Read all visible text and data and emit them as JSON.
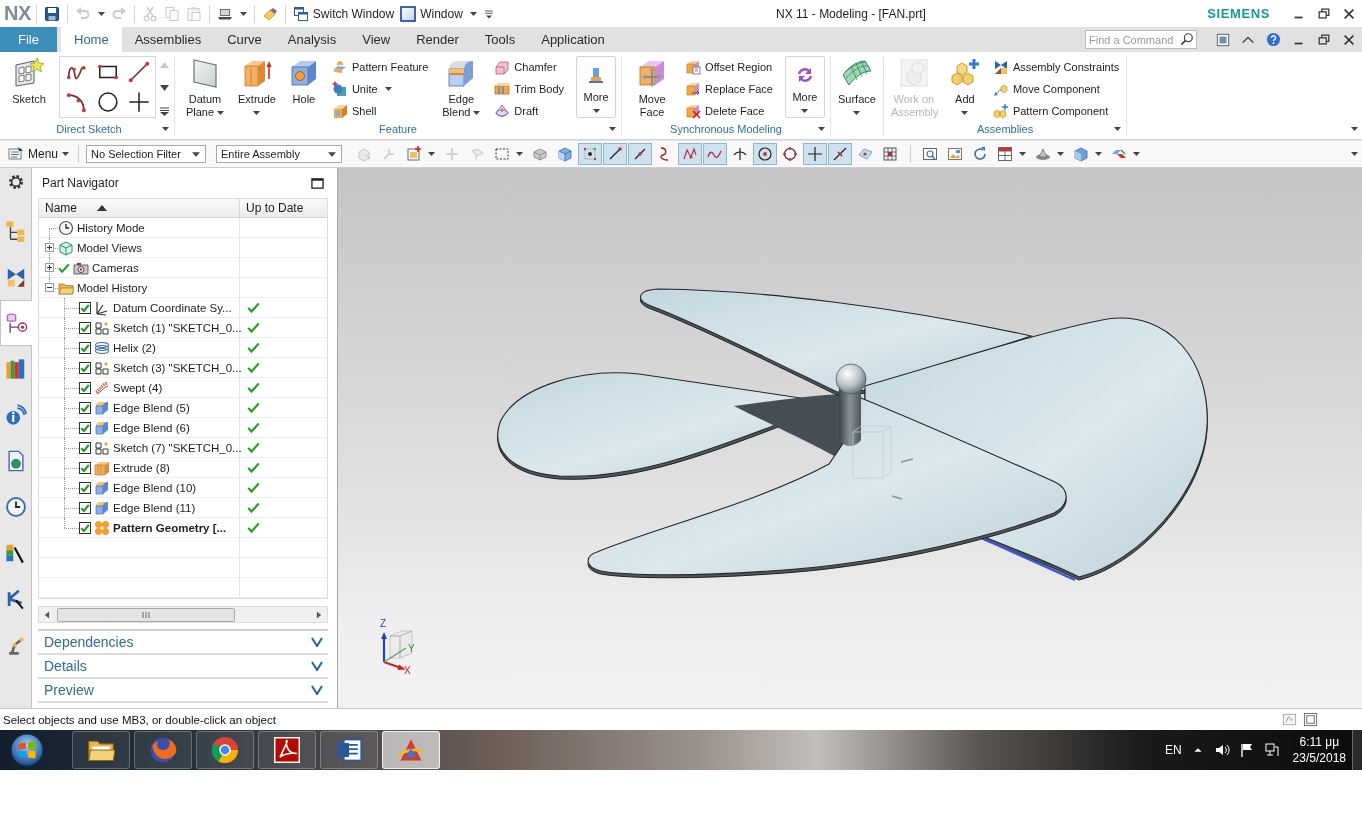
{
  "window": {
    "logo": "NX",
    "title": "NX 11 - Modeling - [FAN.prt]",
    "brand": "SIEMENS"
  },
  "quick_access": {
    "tool_groups": [
      [
        {
          "kind": "save",
          "disabled": false,
          "dropdown": false
        }
      ],
      [
        {
          "kind": "undo",
          "disabled": true,
          "dropdown": true
        },
        {
          "kind": "redo",
          "disabled": true,
          "dropdown": false
        }
      ],
      [
        {
          "kind": "cut",
          "disabled": true,
          "dropdown": false
        },
        {
          "kind": "copy",
          "disabled": true,
          "dropdown": false
        },
        {
          "kind": "paste",
          "disabled": true,
          "dropdown": false
        }
      ],
      [
        {
          "kind": "touch",
          "disabled": false,
          "dropdown": true
        }
      ],
      [
        {
          "kind": "eraser",
          "disabled": false,
          "dropdown": false
        }
      ]
    ],
    "buttons": [
      {
        "kind": "switch-window",
        "label": "Switch Window",
        "dropdown": false
      },
      {
        "kind": "window",
        "label": "Window",
        "dropdown": true
      }
    ]
  },
  "ribbon": {
    "tabs": [
      {
        "label": "File",
        "kind": "file",
        "selected": false
      },
      {
        "label": "Home",
        "kind": "tab",
        "selected": true
      },
      {
        "label": "Assemblies",
        "kind": "tab",
        "selected": false
      },
      {
        "label": "Curve",
        "kind": "tab",
        "selected": false
      },
      {
        "label": "Analysis",
        "kind": "tab",
        "selected": false
      },
      {
        "label": "View",
        "kind": "tab",
        "selected": false
      },
      {
        "label": "Render",
        "kind": "tab",
        "selected": false
      },
      {
        "label": "Tools",
        "kind": "tab",
        "selected": false
      },
      {
        "label": "Application",
        "kind": "tab",
        "selected": false
      }
    ],
    "search": {
      "placeholder": "Find a Command"
    },
    "groups": [
      {
        "label": "Direct Sketch",
        "launcher": true,
        "items": [
          {
            "kind": "sketch",
            "label": "Sketch",
            "dropdown": false,
            "disabled": false
          },
          {
            "kind": "gallery",
            "tools": [
              {
                "kind": "spline"
              },
              {
                "kind": "rectangle"
              },
              {
                "kind": "line"
              },
              {
                "kind": "arc"
              },
              {
                "kind": "circle"
              },
              {
                "kind": "point"
              }
            ]
          }
        ]
      },
      {
        "label": "Feature",
        "launcher": true,
        "items": [
          {
            "kind": "datum-plane",
            "label": "Datum Plane",
            "dropdown": true,
            "disabled": false
          },
          {
            "kind": "extrude",
            "label": "Extrude",
            "dropdown": true,
            "disabled": false
          },
          {
            "kind": "hole",
            "label": "Hole",
            "dropdown": false,
            "disabled": false
          },
          {
            "kind": "stack",
            "buttons": [
              {
                "kind": "pattern-feature",
                "label": "Pattern Feature",
                "dropdown": false
              },
              {
                "kind": "unite",
                "label": "Unite",
                "dropdown": true
              },
              {
                "kind": "shell",
                "label": "Shell",
                "dropdown": false
              }
            ]
          },
          {
            "kind": "edge-blend",
            "label": "Edge Blend",
            "dropdown": true,
            "disabled": false
          },
          {
            "kind": "stack",
            "buttons": [
              {
                "kind": "chamfer",
                "label": "Chamfer",
                "dropdown": false
              },
              {
                "kind": "trim-body",
                "label": "Trim Body",
                "dropdown": false
              },
              {
                "kind": "draft",
                "label": "Draft",
                "dropdown": false
              }
            ]
          },
          {
            "kind": "more-feature",
            "label": "More",
            "dropdown": true,
            "disabled": false
          }
        ]
      },
      {
        "label": "Synchronous Modeling",
        "launcher": true,
        "items": [
          {
            "kind": "move-face",
            "label": "Move Face",
            "dropdown": false,
            "disabled": false
          },
          {
            "kind": "stack",
            "buttons": [
              {
                "kind": "offset-region",
                "label": "Offset Region",
                "dropdown": false
              },
              {
                "kind": "replace-face",
                "label": "Replace Face",
                "dropdown": false
              },
              {
                "kind": "delete-face",
                "label": "Delete Face",
                "dropdown": false
              }
            ]
          },
          {
            "kind": "more-sync",
            "label": "More",
            "dropdown": true,
            "disabled": false
          }
        ]
      },
      {
        "launcher": false,
        "items": [
          {
            "kind": "surface",
            "label": "Surface",
            "dropdown": true,
            "disabled": false
          }
        ]
      },
      {
        "label": "Assemblies",
        "launcher": true,
        "items": [
          {
            "kind": "work-on-assembly",
            "label": "Work on Assembly",
            "dropdown": false,
            "disabled": true
          },
          {
            "kind": "add-component",
            "label": "Add",
            "dropdown": true,
            "disabled": false
          },
          {
            "kind": "stack",
            "buttons": [
              {
                "kind": "assembly-constraints",
                "label": "Assembly Constraints",
                "dropdown": false
              },
              {
                "kind": "move-component",
                "label": "Move Component",
                "dropdown": false
              },
              {
                "kind": "pattern-component",
                "label": "Pattern Component",
                "dropdown": false
              }
            ]
          }
        ]
      }
    ]
  },
  "toolbar": {
    "menu": "Menu",
    "selection_filter": "No Selection Filter",
    "assembly_scope": "Entire Assembly",
    "icon_groups": [
      [
        {
          "kind": "select-feature",
          "on": false,
          "disabled": true,
          "dropdown": false
        },
        {
          "kind": "select-arrow",
          "on": false,
          "disabled": true,
          "dropdown": false
        },
        {
          "kind": "box-plus",
          "on": false,
          "disabled": false,
          "dropdown": true
        },
        {
          "kind": "move-handle",
          "on": false,
          "disabled": true,
          "dropdown": false
        },
        {
          "kind": "select-face",
          "on": false,
          "disabled": true,
          "dropdown": false
        },
        {
          "kind": "dashed-rect",
          "on": false,
          "disabled": false,
          "dropdown": true
        },
        {
          "kind": "cube-grey",
          "on": false,
          "disabled": false,
          "dropdown": false
        },
        {
          "kind": "cube-blue",
          "on": false,
          "disabled": false,
          "dropdown": false
        },
        {
          "kind": "snap-grid",
          "on": true,
          "disabled": false,
          "dropdown": false
        },
        {
          "kind": "end-point",
          "on": true,
          "disabled": false,
          "dropdown": false
        },
        {
          "kind": "mid-point",
          "on": true,
          "disabled": false,
          "dropdown": false
        },
        {
          "kind": "curve",
          "on": false,
          "disabled": false,
          "dropdown": false
        },
        {
          "kind": "control-point",
          "on": true,
          "disabled": false,
          "dropdown": false
        },
        {
          "kind": "wave",
          "on": true,
          "disabled": false,
          "dropdown": false
        },
        {
          "kind": "intersection",
          "on": false,
          "disabled": false,
          "dropdown": false
        },
        {
          "kind": "arc-center",
          "on": true,
          "disabled": false,
          "dropdown": false
        },
        {
          "kind": "quadrant",
          "on": false,
          "disabled": false,
          "dropdown": false
        },
        {
          "kind": "existing-point",
          "on": true,
          "disabled": false,
          "dropdown": false
        },
        {
          "kind": "point-on-curve",
          "on": true,
          "disabled": false,
          "dropdown": false
        },
        {
          "kind": "point-on-surface",
          "on": false,
          "disabled": false,
          "dropdown": false
        },
        {
          "kind": "grid",
          "on": false,
          "disabled": false,
          "dropdown": false
        }
      ],
      [
        {
          "kind": "view-fit",
          "on": false,
          "disabled": false,
          "dropdown": false
        },
        {
          "kind": "image",
          "on": false,
          "disabled": false,
          "dropdown": false
        },
        {
          "kind": "refresh",
          "on": false,
          "disabled": false,
          "dropdown": false
        },
        {
          "kind": "layout",
          "on": false,
          "disabled": false,
          "dropdown": true
        },
        {
          "kind": "shade",
          "on": false,
          "disabled": false,
          "dropdown": true
        },
        {
          "kind": "cube-display",
          "on": false,
          "disabled": false,
          "dropdown": true
        },
        {
          "kind": "show-hide",
          "on": false,
          "disabled": false,
          "dropdown": true
        }
      ]
    ]
  },
  "resource_bar": [
    {
      "kind": "settings",
      "selected": false
    },
    {
      "kind": "assembly-navigator",
      "selected": false
    },
    {
      "kind": "constraint-navigator",
      "selected": false
    },
    {
      "kind": "part-navigator",
      "selected": true
    },
    {
      "kind": "reuse-library",
      "selected": false
    },
    {
      "kind": "hd3d",
      "selected": false
    },
    {
      "kind": "web-browser",
      "selected": false
    },
    {
      "kind": "history",
      "selected": false
    },
    {
      "kind": "process-studio",
      "selected": false
    },
    {
      "kind": "roles",
      "selected": false
    },
    {
      "kind": "system-scenes",
      "selected": false
    }
  ],
  "part_navigator": {
    "title": "Part Navigator",
    "columns": [
      {
        "label": "Name",
        "sorted": true
      },
      {
        "label": "Up to Date",
        "sorted": false
      }
    ],
    "nodes": [
      {
        "label": "History Mode",
        "kind": "history-mode",
        "ticked": false
      },
      {
        "label": "Model Views",
        "kind": "model-views",
        "ticked": false,
        "expanded": false
      },
      {
        "label": "Cameras",
        "kind": "cameras",
        "ticked": true,
        "expanded": false
      },
      {
        "label": "Model History",
        "kind": "folder",
        "ticked": false,
        "expanded": true,
        "children": [
          {
            "label": "Datum Coordinate Sy...",
            "kind": "datum-csys",
            "checked": true,
            "up_to_date": true,
            "current": false
          },
          {
            "label": "Sketch (1) \"SKETCH_0...",
            "kind": "sketch-feature",
            "checked": true,
            "up_to_date": true,
            "current": false
          },
          {
            "label": "Helix (2)",
            "kind": "helix",
            "checked": true,
            "up_to_date": true,
            "current": false
          },
          {
            "label": "Sketch (3) \"SKETCH_0...",
            "kind": "sketch-feature",
            "checked": true,
            "up_to_date": true,
            "current": false
          },
          {
            "label": "Swept (4)",
            "kind": "swept",
            "checked": true,
            "up_to_date": true,
            "current": false
          },
          {
            "label": "Edge Blend (5)",
            "kind": "blend-feature",
            "checked": true,
            "up_to_date": true,
            "current": false
          },
          {
            "label": "Edge Blend (6)",
            "kind": "blend-feature",
            "checked": true,
            "up_to_date": true,
            "current": false
          },
          {
            "label": "Sketch (7) \"SKETCH_0...",
            "kind": "sketch-feature",
            "checked": true,
            "up_to_date": true,
            "current": false
          },
          {
            "label": "Extrude (8)",
            "kind": "extrude-feature",
            "checked": true,
            "up_to_date": true,
            "current": false
          },
          {
            "label": "Edge Blend (10)",
            "kind": "blend-feature",
            "checked": true,
            "up_to_date": true,
            "current": false
          },
          {
            "label": "Edge Blend (11)",
            "kind": "blend-feature",
            "checked": true,
            "up_to_date": true,
            "current": false
          },
          {
            "label": "Pattern Geometry [...",
            "kind": "pattern-geometry",
            "checked": true,
            "up_to_date": true,
            "current": true
          }
        ]
      }
    ],
    "panels": [
      {
        "label": "Dependencies",
        "expanded": false
      },
      {
        "label": "Details",
        "expanded": false
      },
      {
        "label": "Preview",
        "expanded": false
      }
    ]
  },
  "viewport": {
    "triad": {
      "z": "Z",
      "y": "Y",
      "x": "X"
    }
  },
  "status_bar": {
    "prompt": "Select objects and use MB3, or double-click an object"
  },
  "taskbar": {
    "apps": [
      {
        "kind": "file-manager",
        "active": false
      },
      {
        "kind": "fox-browser",
        "active": false
      },
      {
        "kind": "orb-browser",
        "active": false
      },
      {
        "kind": "pdf-reader",
        "active": false
      },
      {
        "kind": "word-processor",
        "active": false
      },
      {
        "kind": "cad-app",
        "active": true
      }
    ],
    "language": "EN",
    "time": "6:11 μμ",
    "date": "23/5/2018"
  }
}
